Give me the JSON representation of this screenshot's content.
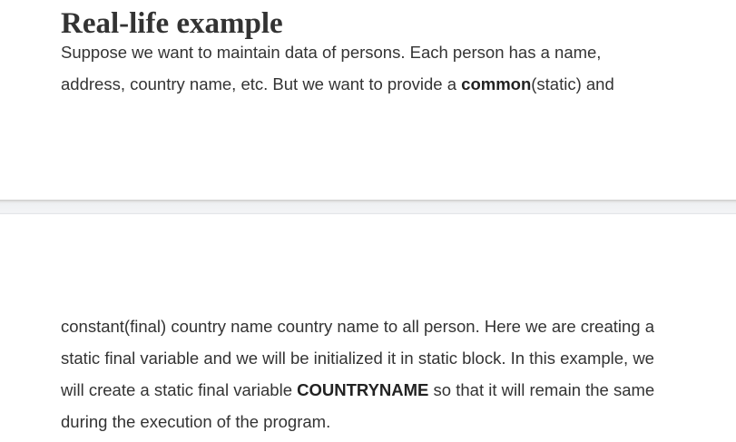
{
  "heading": "Real-life example",
  "paragraph_top": {
    "line1": "Suppose we want to maintain data of persons. Each person has a name,",
    "line2_before": "address, country name, etc. But we want to provide a ",
    "line2_bold": "common",
    "line2_after": "(static) and"
  },
  "paragraph_bottom": {
    "line1": "constant(final) country name country name to all person. Here we are creating a",
    "line2": "static final variable and we will be initialized it in static block. In this example, we",
    "line3_before": "will create a static final variable ",
    "line3_bold": "COUNTRYNAME",
    "line3_after": " so that it will remain the same",
    "line4": "during the execution of the program."
  }
}
